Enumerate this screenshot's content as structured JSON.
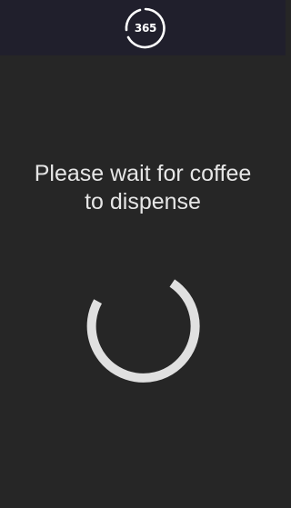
{
  "header": {
    "logo_text": "365"
  },
  "main": {
    "message_line1": "Please wait for coffee",
    "message_line2": "to dispense"
  },
  "spinner": {
    "icon": "loading-spinner-icon",
    "color": "#e0e0e0"
  },
  "colors": {
    "background": "#262626",
    "header": "#201f2c",
    "text": "#e6e6e6"
  }
}
